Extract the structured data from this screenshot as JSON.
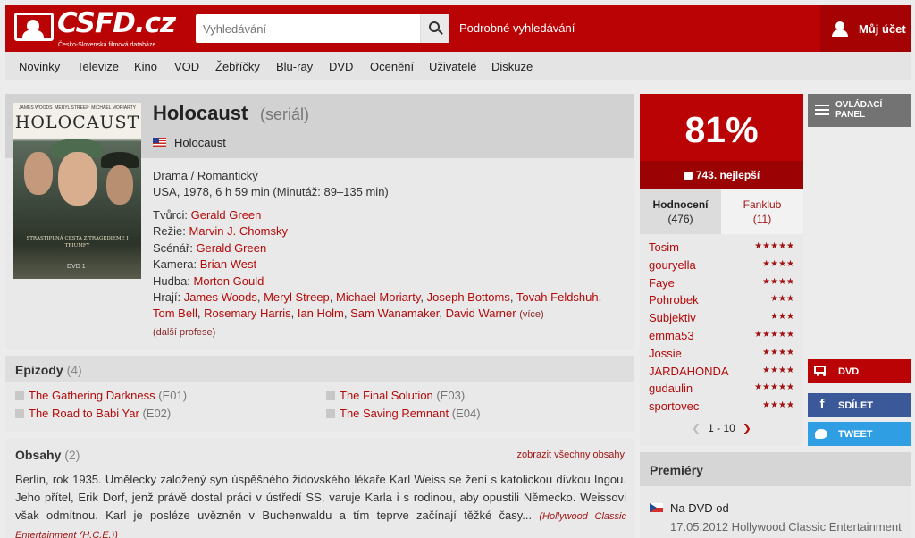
{
  "header": {
    "logo_text": "CSFD.cz",
    "logo_subtitle": "Česko-Slovenská filmová databáze",
    "search_placeholder": "Vyhledávání",
    "advanced_search": "Podrobné vyhledávání",
    "account": "Můj účet"
  },
  "nav": {
    "items": [
      "Novinky",
      "Televize",
      "Kino",
      "VOD",
      "Žebříčky",
      "Blu-ray",
      "DVD",
      "Ocenění",
      "Uživatelé",
      "Diskuze"
    ]
  },
  "film": {
    "title": "Holocaust",
    "type": "(seriál)",
    "original_title": "Holocaust",
    "genres": "Drama / Romantický",
    "origin": "USA, 1978, 6 h 59 min (Minutáž: 89–135 min)",
    "poster": {
      "names": [
        "JAMES WOODS",
        "MERYL STREEP",
        "MICHAEL MORIARTY"
      ],
      "title": "HOLOCAUST",
      "tagline": "STRASTIPLNÁ CESTA Z TRAGÉDIEME I TRIUMFY",
      "format": "DVD 1"
    },
    "creators": {
      "tvurci_label": "Tvůrci:",
      "tvurci": "Gerald Green",
      "rezie_label": "Režie:",
      "rezie": "Marvin J. Chomsky",
      "scenar_label": "Scénář:",
      "scenar": "Gerald Green",
      "kamera_label": "Kamera:",
      "kamera": "Brian West",
      "hudba_label": "Hudba:",
      "hudba": "Morton Gould",
      "hraji_label": "Hrají:",
      "hraji": [
        "James Woods",
        "Meryl Streep",
        "Michael Moriarty",
        "Joseph Bottoms",
        "Tovah Feldshuh",
        "Tom Bell",
        "Rosemary Harris",
        "Ian Holm",
        "Sam Wanamaker",
        "David Warner"
      ],
      "more": "(více)",
      "other_professions": "(další profese)"
    }
  },
  "episodes": {
    "heading": "Epizody",
    "count": "(4)",
    "items": [
      {
        "name": "The Gathering Darkness",
        "code": "(E01)"
      },
      {
        "name": "The Road to Babi Yar",
        "code": "(E02)"
      },
      {
        "name": "The Final Solution",
        "code": "(E03)"
      },
      {
        "name": "The Saving Remnant",
        "code": "(E04)"
      }
    ]
  },
  "plots": {
    "heading": "Obsahy",
    "count": "(2)",
    "show_all": "zobrazit všechny obsahy",
    "text": "Berlín, rok 1935. Umělecky založený syn úspěšného židovského lékaře Karl Weiss se žení s katolickou dívkou Ingou. Jeho přítel, Erik Dorf, jenž právě dostal práci v ústředí SS, varuje Karla i s rodinou, aby opustili Německo. Weissovi však odmítnou. Karl je posléze uvězněn v Buchenwaldu a tím teprve začínají těžké časy...",
    "source": "(Hollywood Classic Entertainment (H.C.E.))"
  },
  "rating": {
    "percent": "81%",
    "rank": "743. nejlepší",
    "tab_ratings": "Hodnocení",
    "tab_ratings_count": "(476)",
    "tab_fanclub": "Fanklub",
    "tab_fanclub_count": "(11)",
    "users": [
      {
        "name": "Tosim",
        "stars": 5
      },
      {
        "name": "gouryella",
        "stars": 4
      },
      {
        "name": "Faye",
        "stars": 4
      },
      {
        "name": "Pohrobek",
        "stars": 3
      },
      {
        "name": "Subjektiv",
        "stars": 3
      },
      {
        "name": "emma53",
        "stars": 5
      },
      {
        "name": "Jossie",
        "stars": 4
      },
      {
        "name": "JARDAHONDA",
        "stars": 4
      },
      {
        "name": "gudaulin",
        "stars": 5
      },
      {
        "name": "sportovec",
        "stars": 4
      }
    ],
    "pager": "1 - 10"
  },
  "side": {
    "panel": "OVLÁDACÍ PANEL",
    "dvd": "DVD",
    "share": "SDÍLET",
    "tweet": "TWEET"
  },
  "premieres": {
    "heading": "Premiéry",
    "type": "Na DVD od",
    "detail": "17.05.2012 Hollywood Classic Entertainment"
  },
  "colors": {
    "brand_red": "#ba0305",
    "facebook": "#3b5998",
    "twitter": "#2f9ee3"
  }
}
